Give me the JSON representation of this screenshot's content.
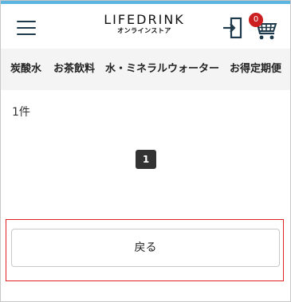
{
  "header": {
    "logo_main": "LIFEDRINK",
    "logo_sub": "オンラインストア",
    "menu_icon": "hamburger-menu-icon",
    "login_icon": "login-door-icon",
    "cart_icon": "shopping-cart-icon",
    "cart_count": "0"
  },
  "categories": [
    {
      "label": "炭酸水"
    },
    {
      "label": "お茶飲料"
    },
    {
      "label": "水・ミネラルウォーター"
    },
    {
      "label": "お得定期便"
    }
  ],
  "results": {
    "count_label": "1件"
  },
  "pagination": {
    "current_page": "1"
  },
  "actions": {
    "back_label": "戻る"
  },
  "colors": {
    "accent_top": "#5ab4e0",
    "badge": "#cc1f1f",
    "highlight": "#e02020",
    "icon_dark": "#1e3a4a"
  }
}
